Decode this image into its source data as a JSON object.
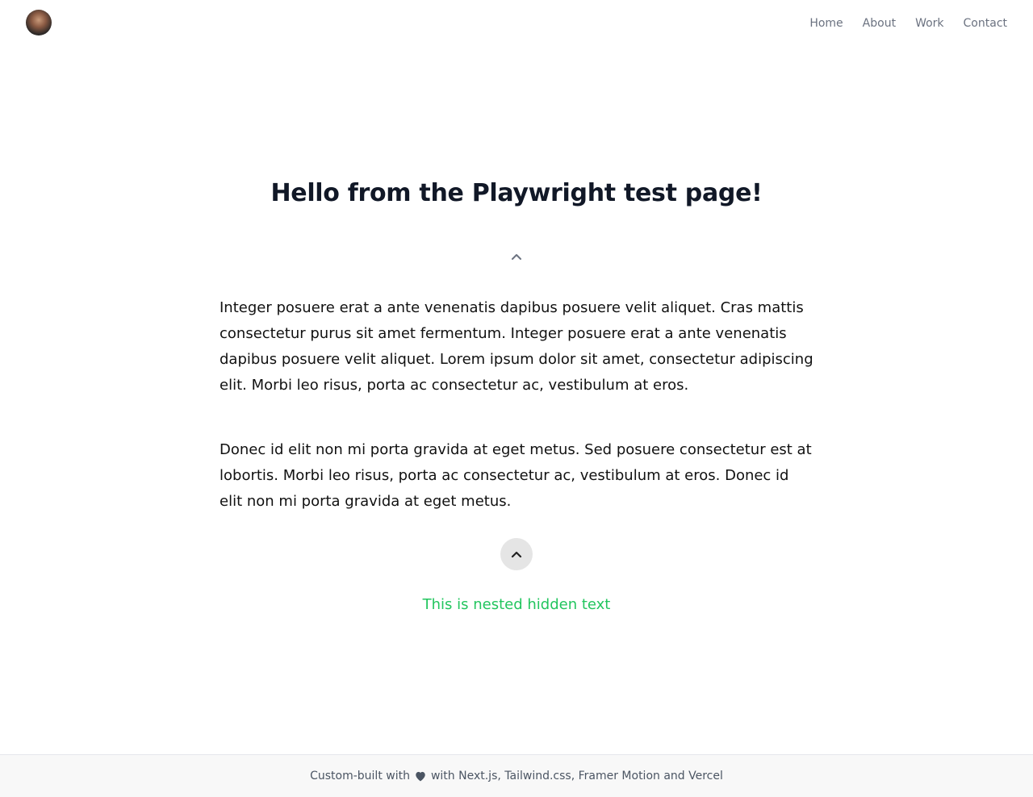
{
  "header": {
    "nav": [
      {
        "label": "Home"
      },
      {
        "label": "About"
      },
      {
        "label": "Work"
      },
      {
        "label": "Contact"
      }
    ]
  },
  "main": {
    "title": "Hello from the Playwright test page!",
    "paragraph_1": "Integer posuere erat a ante venenatis dapibus posuere velit aliquet. Cras mattis consectetur purus sit amet fermentum. Integer posuere erat a ante venenatis dapibus posuere velit aliquet. Lorem ipsum dolor sit amet, consectetur adipiscing elit. Morbi leo risus, porta ac consectetur ac, vestibulum at eros.",
    "paragraph_2": "Donec id elit non mi porta gravida at eget metus. Sed posuere consectetur est at lobortis. Morbi leo risus, porta ac consectetur ac, vestibulum at eros. Donec id elit non mi porta gravida at eget metus.",
    "hidden_text": "This is nested hidden text"
  },
  "footer": {
    "prefix": "Custom-built with",
    "suffix": "with Next.js, Tailwind.css, Framer Motion and Vercel"
  },
  "icons": {
    "collapse_small": "chevron-up-icon",
    "collapse_button": "chevron-up-icon",
    "love": "heart-icon"
  },
  "colors": {
    "title": "#111827",
    "hidden_text": "#22c55e",
    "nav_text": "#6b7280",
    "button_bg": "#e5e5e5",
    "footer_bg": "#f8f8f8"
  }
}
